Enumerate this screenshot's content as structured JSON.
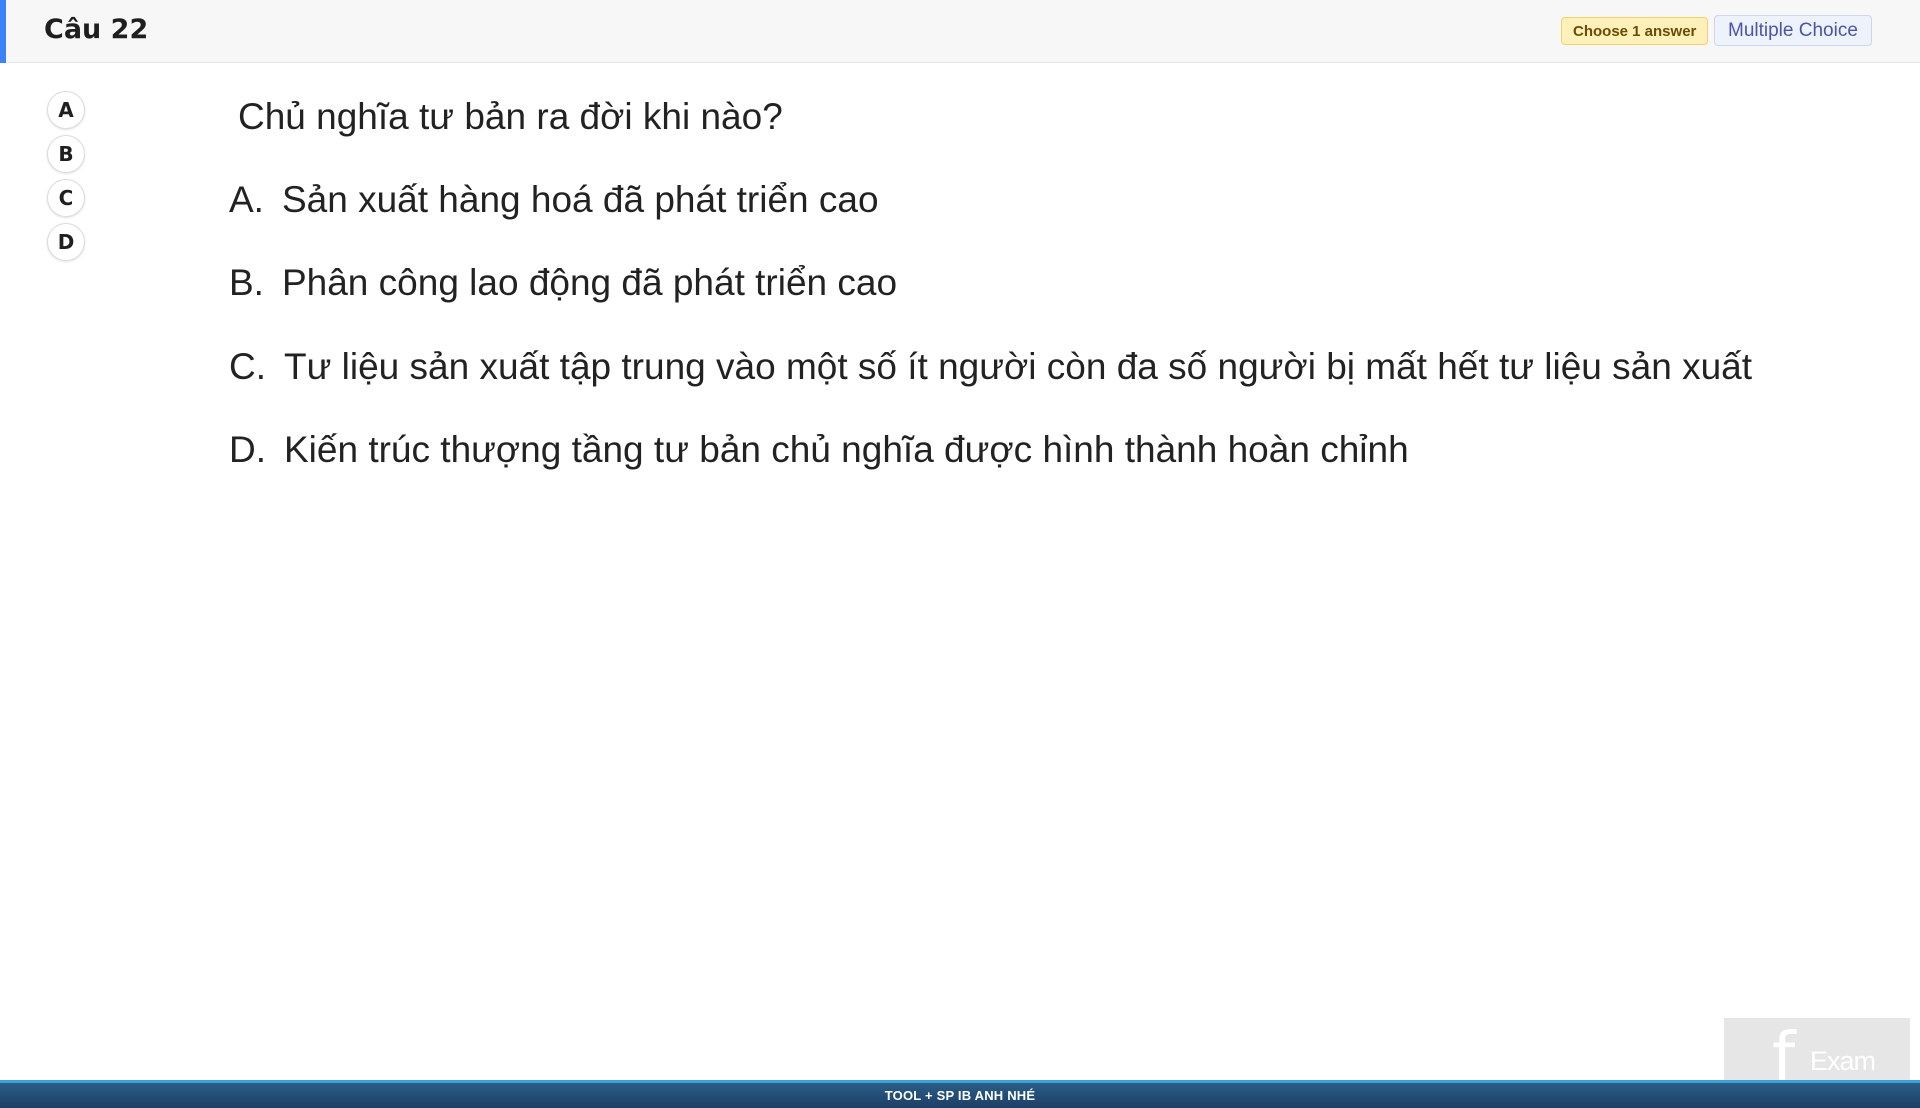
{
  "header": {
    "question_number": "Câu 22",
    "badge_answer": "Choose 1 answer",
    "badge_type": "Multiple Choice",
    "accent_color": "#3b82f6"
  },
  "answer_buttons": [
    "A",
    "B",
    "C",
    "D"
  ],
  "question": {
    "text": "Chủ nghĩa tư bản ra đời khi nào?",
    "choices": [
      {
        "letter": "A.",
        "text": "Sản xuất hàng hoá đã phát triển cao"
      },
      {
        "letter": "B.",
        "text": "Phân công lao động đã phát triển cao"
      },
      {
        "letter": "C.",
        "text": "Tư liệu sản xuất tập trung vào một số ít người còn đa số người bị mất hết tư liệu sản xuất"
      },
      {
        "letter": "D.",
        "text": "Kiến trúc thượng tầng tư bản chủ nghĩa được hình thành hoàn chỉnh"
      }
    ]
  },
  "watermark": {
    "text": "Exam"
  },
  "footer": {
    "text": "TOOL + SP IB ANH NHÉ"
  }
}
